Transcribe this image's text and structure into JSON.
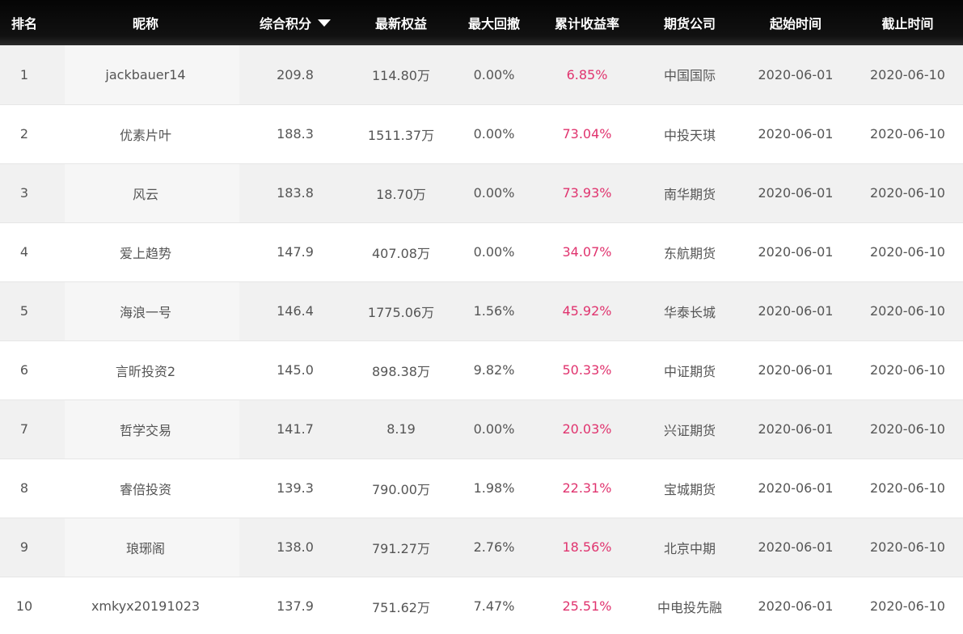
{
  "colors": {
    "header_bg": "#0a0a0a",
    "header_text": "#ffffff",
    "row_alt_bg": "#f1f1f1",
    "row_bg": "#ffffff",
    "text": "#555555",
    "return_text": "#e0336e"
  },
  "table": {
    "headers": {
      "rank": "排名",
      "nickname": "昵称",
      "score": "综合积分",
      "equity": "最新权益",
      "max_drawdown": "最大回撤",
      "cumulative_return": "累计收益率",
      "futures_firm": "期货公司",
      "start_date": "起始时间",
      "end_date": "截止时间"
    },
    "sort_icon": "sort-down-triangle-icon",
    "rows": [
      {
        "rank": "1",
        "nickname": "jackbauer14",
        "score": "209.8",
        "equity": "114.80万",
        "max_drawdown": "0.00%",
        "cumulative_return": "6.85%",
        "futures_firm": "中国国际",
        "start_date": "2020-06-01",
        "end_date": "2020-06-10"
      },
      {
        "rank": "2",
        "nickname": "优素片叶",
        "score": "188.3",
        "equity": "1511.37万",
        "max_drawdown": "0.00%",
        "cumulative_return": "73.04%",
        "futures_firm": "中投天琪",
        "start_date": "2020-06-01",
        "end_date": "2020-06-10"
      },
      {
        "rank": "3",
        "nickname": "风云",
        "score": "183.8",
        "equity": "18.70万",
        "max_drawdown": "0.00%",
        "cumulative_return": "73.93%",
        "futures_firm": "南华期货",
        "start_date": "2020-06-01",
        "end_date": "2020-06-10"
      },
      {
        "rank": "4",
        "nickname": "爱上趋势",
        "score": "147.9",
        "equity": "407.08万",
        "max_drawdown": "0.00%",
        "cumulative_return": "34.07%",
        "futures_firm": "东航期货",
        "start_date": "2020-06-01",
        "end_date": "2020-06-10"
      },
      {
        "rank": "5",
        "nickname": "海浪一号",
        "score": "146.4",
        "equity": "1775.06万",
        "max_drawdown": "1.56%",
        "cumulative_return": "45.92%",
        "futures_firm": "华泰长城",
        "start_date": "2020-06-01",
        "end_date": "2020-06-10"
      },
      {
        "rank": "6",
        "nickname": "言昕投资2",
        "score": "145.0",
        "equity": "898.38万",
        "max_drawdown": "9.82%",
        "cumulative_return": "50.33%",
        "futures_firm": "中证期货",
        "start_date": "2020-06-01",
        "end_date": "2020-06-10"
      },
      {
        "rank": "7",
        "nickname": "哲学交易",
        "score": "141.7",
        "equity": "8.19",
        "max_drawdown": "0.00%",
        "cumulative_return": "20.03%",
        "futures_firm": "兴证期货",
        "start_date": "2020-06-01",
        "end_date": "2020-06-10"
      },
      {
        "rank": "8",
        "nickname": "睿倍投资",
        "score": "139.3",
        "equity": "790.00万",
        "max_drawdown": "1.98%",
        "cumulative_return": "22.31%",
        "futures_firm": "宝城期货",
        "start_date": "2020-06-01",
        "end_date": "2020-06-10"
      },
      {
        "rank": "9",
        "nickname": "琅琊阁",
        "score": "138.0",
        "equity": "791.27万",
        "max_drawdown": "2.76%",
        "cumulative_return": "18.56%",
        "futures_firm": "北京中期",
        "start_date": "2020-06-01",
        "end_date": "2020-06-10"
      },
      {
        "rank": "10",
        "nickname": "xmkyx20191023",
        "score": "137.9",
        "equity": "751.62万",
        "max_drawdown": "7.47%",
        "cumulative_return": "25.51%",
        "futures_firm": "中电投先融",
        "start_date": "2020-06-01",
        "end_date": "2020-06-10"
      }
    ]
  }
}
